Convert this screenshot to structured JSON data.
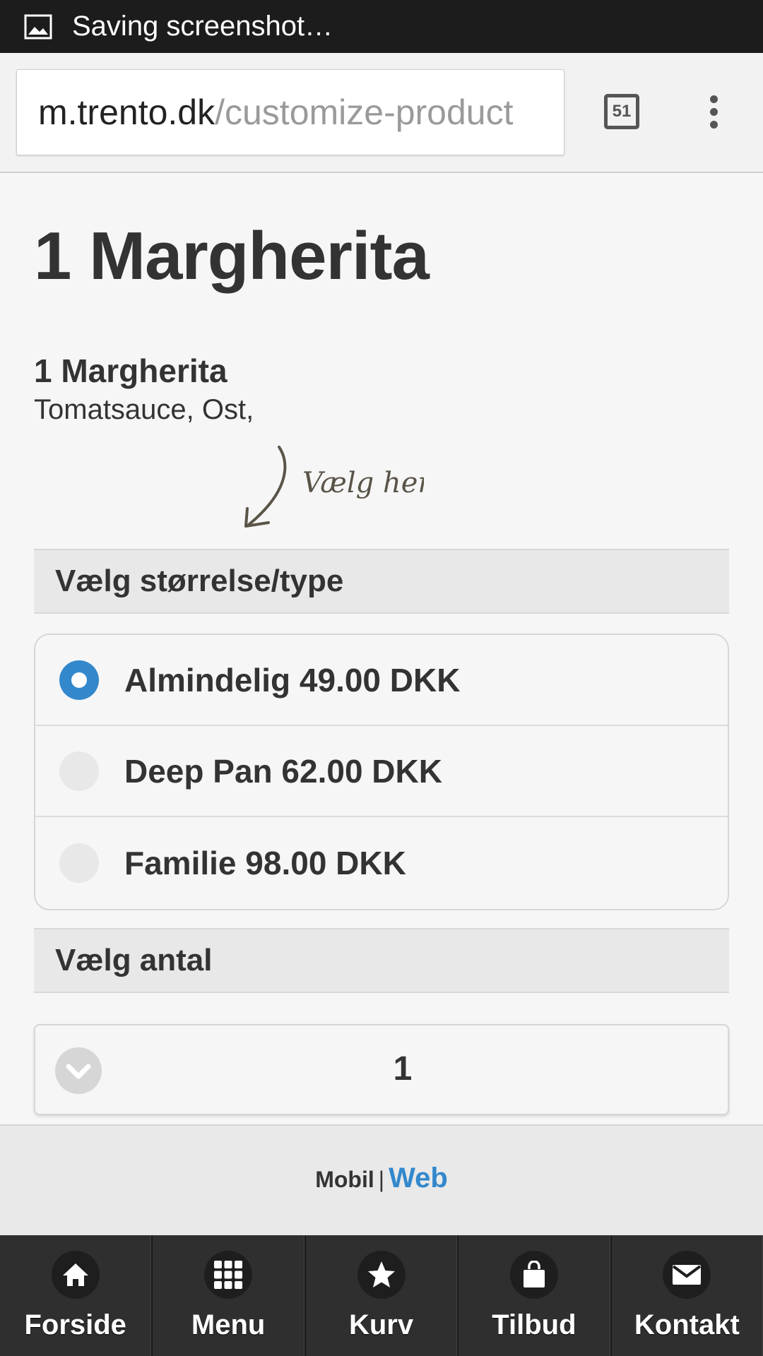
{
  "status_bar": {
    "text": "Saving screenshot…",
    "icon": "image-icon"
  },
  "browser": {
    "url_domain": "m.trento.dk",
    "url_path": "/customize-product",
    "tab_count": "51",
    "menu_icon": "overflow-menu-icon"
  },
  "product": {
    "page_title": "1 Margherita",
    "name": "1 Margherita",
    "description": "Tomatsauce, Ost,",
    "hint": "Vælg her"
  },
  "size_section": {
    "header": "Vælg størrelse/type",
    "options": [
      {
        "label": "Almindelig 49.00 DKK",
        "selected": true
      },
      {
        "label": "Deep Pan 62.00 DKK",
        "selected": false
      },
      {
        "label": "Familie 98.00 DKK",
        "selected": false
      }
    ]
  },
  "quantity_section": {
    "header": "Vælg antal",
    "value": "1"
  },
  "footer": {
    "mobile": "Mobil",
    "separator": "|",
    "web": "Web"
  },
  "bottom_nav": [
    {
      "label": "Forside",
      "icon": "home-icon"
    },
    {
      "label": "Menu",
      "icon": "grid-icon"
    },
    {
      "label": "Kurv",
      "icon": "star-icon"
    },
    {
      "label": "Tilbud",
      "icon": "shopping-bag-icon"
    },
    {
      "label": "Kontakt",
      "icon": "mail-icon"
    }
  ],
  "colors": {
    "accent": "#3388cc",
    "nav_bg": "#2f2f2f",
    "status_bar": "#1c1c1c"
  }
}
